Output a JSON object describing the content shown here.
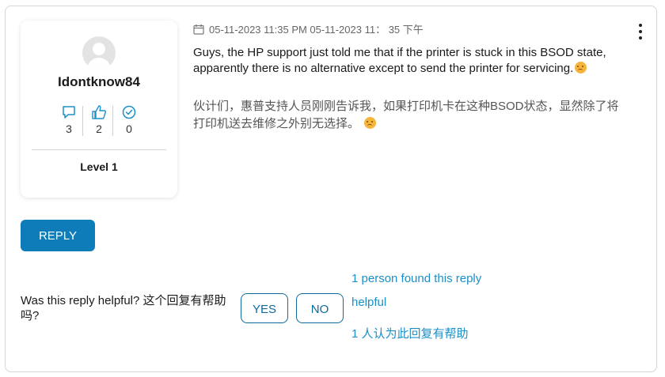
{
  "post": {
    "meta_text": "05-11-2023 11:35 PM 05-11-2023 11： 35 下午",
    "body_en": "Guys, the HP support just told me that if the printer is stuck in this BSOD state, apparently there is no alternative except to send the printer for servicing.",
    "body_zh": "伙计们，惠普支持人员刚刚告诉我，如果打印机卡在这种BSOD状态，显然除了将打印机送去维修之外别无选择。"
  },
  "user": {
    "username": "Idontknow84",
    "stats": {
      "posts": "3",
      "kudos": "2",
      "solutions": "0"
    },
    "level": "Level 1"
  },
  "actions": {
    "reply_label": "REPLY",
    "helpful_question": "Was this reply helpful? 这个回复有帮助吗?",
    "yes_label": "YES",
    "no_label": "NO",
    "found_line1": "1 person found this reply",
    "found_line2": "helpful",
    "found_line3": "1 人认为此回复有帮助"
  },
  "colors": {
    "accent": "#0e7cb9",
    "link": "#1b8fc9",
    "icon_blue": "#1b8fc9"
  },
  "icons": [
    "calendar-icon",
    "kebab-menu-icon",
    "avatar-placeholder-icon",
    "message-icon",
    "thumbs-up-icon",
    "check-circle-icon",
    "disappointed-emoji-icon"
  ]
}
